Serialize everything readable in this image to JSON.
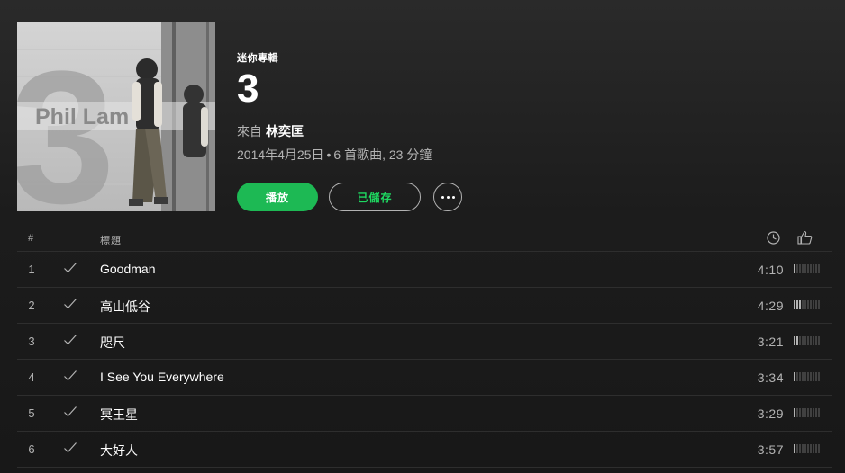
{
  "album": {
    "type_label": "迷你專輯",
    "title": "3",
    "by_prefix": "來自",
    "artist": "林奕匡",
    "release_date": "2014年4月25日",
    "dot": "•",
    "track_summary": "6 首歌曲, 23 分鐘",
    "cover_text": "Phil Lam",
    "cover_number": "3"
  },
  "actions": {
    "play_label": "播放",
    "saved_label": "已儲存"
  },
  "table": {
    "header_num": "#",
    "header_title": "標題"
  },
  "tracks": [
    {
      "num": "1",
      "title": "Goodman",
      "duration": "4:10",
      "popularity": 0.1
    },
    {
      "num": "2",
      "title": "高山低谷",
      "duration": "4:29",
      "popularity": 0.3
    },
    {
      "num": "3",
      "title": "咫尺",
      "duration": "3:21",
      "popularity": 0.2
    },
    {
      "num": "4",
      "title": "I See You Everywhere",
      "duration": "3:34",
      "popularity": 0.1
    },
    {
      "num": "5",
      "title": "冥王星",
      "duration": "3:29",
      "popularity": 0.1
    },
    {
      "num": "6",
      "title": "大好人",
      "duration": "3:57",
      "popularity": 0.1
    }
  ],
  "colors": {
    "accent": "#1db954",
    "saved_text": "#1ed760",
    "background": "#181818",
    "muted_text": "#b3b3b3"
  },
  "icons": {
    "check": "check-icon",
    "clock": "clock-icon",
    "thumb": "thumbs-up-icon",
    "more": "more-icon"
  }
}
